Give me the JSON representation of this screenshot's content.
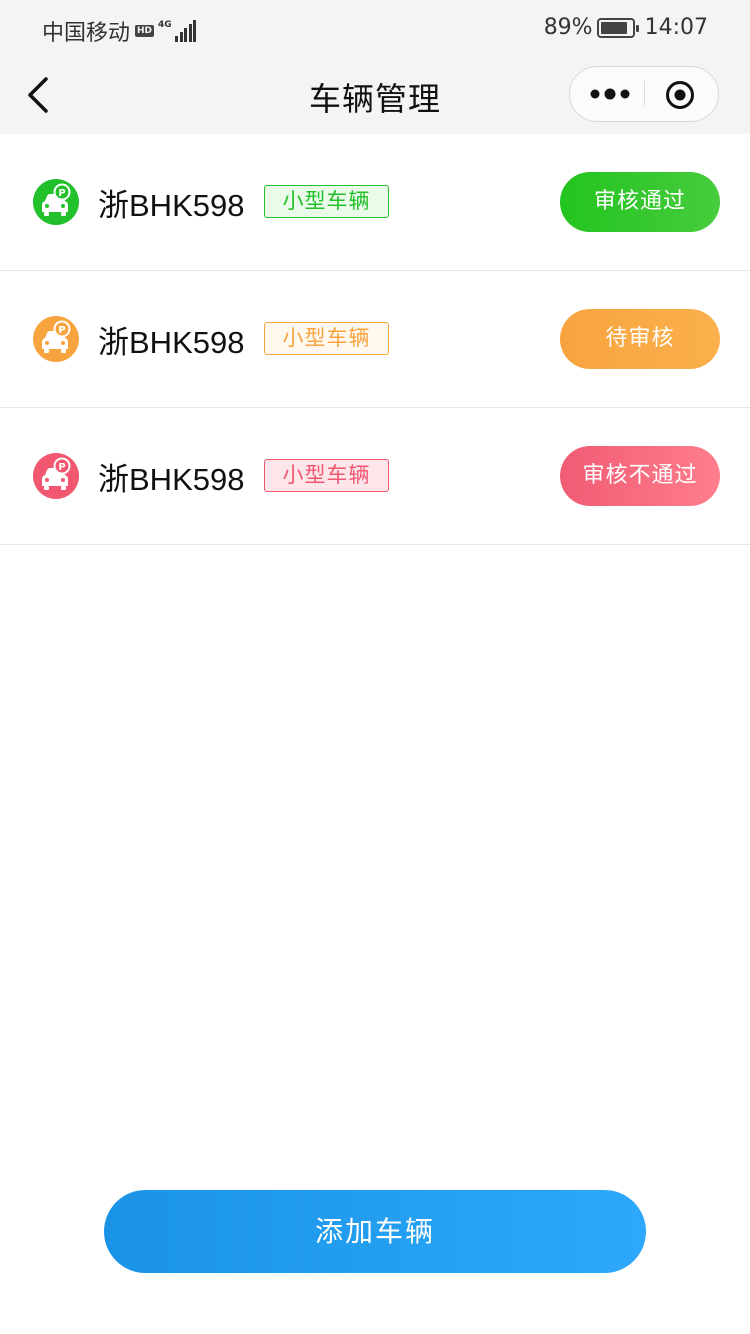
{
  "status_bar": {
    "carrier": "中国移动",
    "hd": "HD",
    "network": "4G",
    "battery_percent": "89%",
    "battery_level": 0.89,
    "time": "14:07"
  },
  "nav": {
    "back_icon": "chevron-left-icon",
    "title": "车辆管理",
    "more_icon": "more-dots-icon",
    "close_icon": "target-circle-icon"
  },
  "vehicles": [
    {
      "plate": "浙BHK598",
      "type": "小型车辆",
      "status": "审核通过",
      "icon": "parking-car-icon",
      "color": "#22c02a",
      "tag_bg": "#eafbe9",
      "btn_from": "#23c41f",
      "btn_to": "#47cc3d"
    },
    {
      "plate": "浙BHK598",
      "type": "小型车辆",
      "status": "待审核",
      "icon": "parking-car-icon",
      "color": "#f7a43f",
      "tag_bg": "#fff8ef",
      "btn_from": "#f7a43f",
      "btn_to": "#fbb04c"
    },
    {
      "plate": "浙BHK598",
      "type": "小型车辆",
      "status": "审核不通过",
      "icon": "parking-car-icon",
      "color": "#f25771",
      "tag_bg": "#fde6ea",
      "btn_from": "#f05b73",
      "btn_to": "#ff7e8d"
    }
  ],
  "add_button": {
    "label": "添加车辆"
  }
}
